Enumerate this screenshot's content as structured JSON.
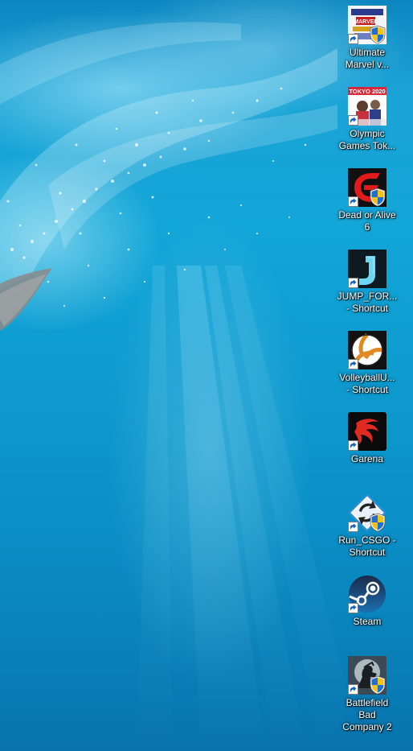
{
  "desktop": {
    "icons": [
      {
        "name": "ultimate-marvel-icon",
        "line1": "Ultimate",
        "line2": "Marvel v...",
        "shortcut": true,
        "shield": true
      },
      {
        "name": "olympic-games-icon",
        "line1": "Olympic",
        "line2": "Games Tok...",
        "shortcut": true,
        "shield": false,
        "badge": "TOKYO 2020"
      },
      {
        "name": "dead-or-alive-icon",
        "line1": "Dead or Alive",
        "line2": "6",
        "shortcut": true,
        "shield": true
      },
      {
        "name": "jump-force-icon",
        "line1": "JUMP_FOR...",
        "line2": "- Shortcut",
        "shortcut": true,
        "shield": false
      },
      {
        "name": "volleyball-icon",
        "line1": "VolleyballU...",
        "line2": "- Shortcut",
        "shortcut": true,
        "shield": false
      },
      {
        "name": "garena-icon",
        "line1": "Garena",
        "line2": "",
        "shortcut": true,
        "shield": false
      },
      {
        "name": "run-csgo-icon",
        "line1": "Run_CSGO -",
        "line2": "Shortcut",
        "shortcut": true,
        "shield": true
      },
      {
        "name": "steam-icon",
        "line1": "Steam",
        "line2": "",
        "shortcut": true,
        "shield": false
      },
      {
        "name": "battlefield-icon",
        "line1": "Battlefield",
        "line2": "Bad",
        "line3": "Company 2",
        "shortcut": true,
        "shield": true
      }
    ]
  },
  "colors": {
    "water_top": "#0c86c0",
    "water_bottom": "#0874ad",
    "label": "#ffffff"
  }
}
